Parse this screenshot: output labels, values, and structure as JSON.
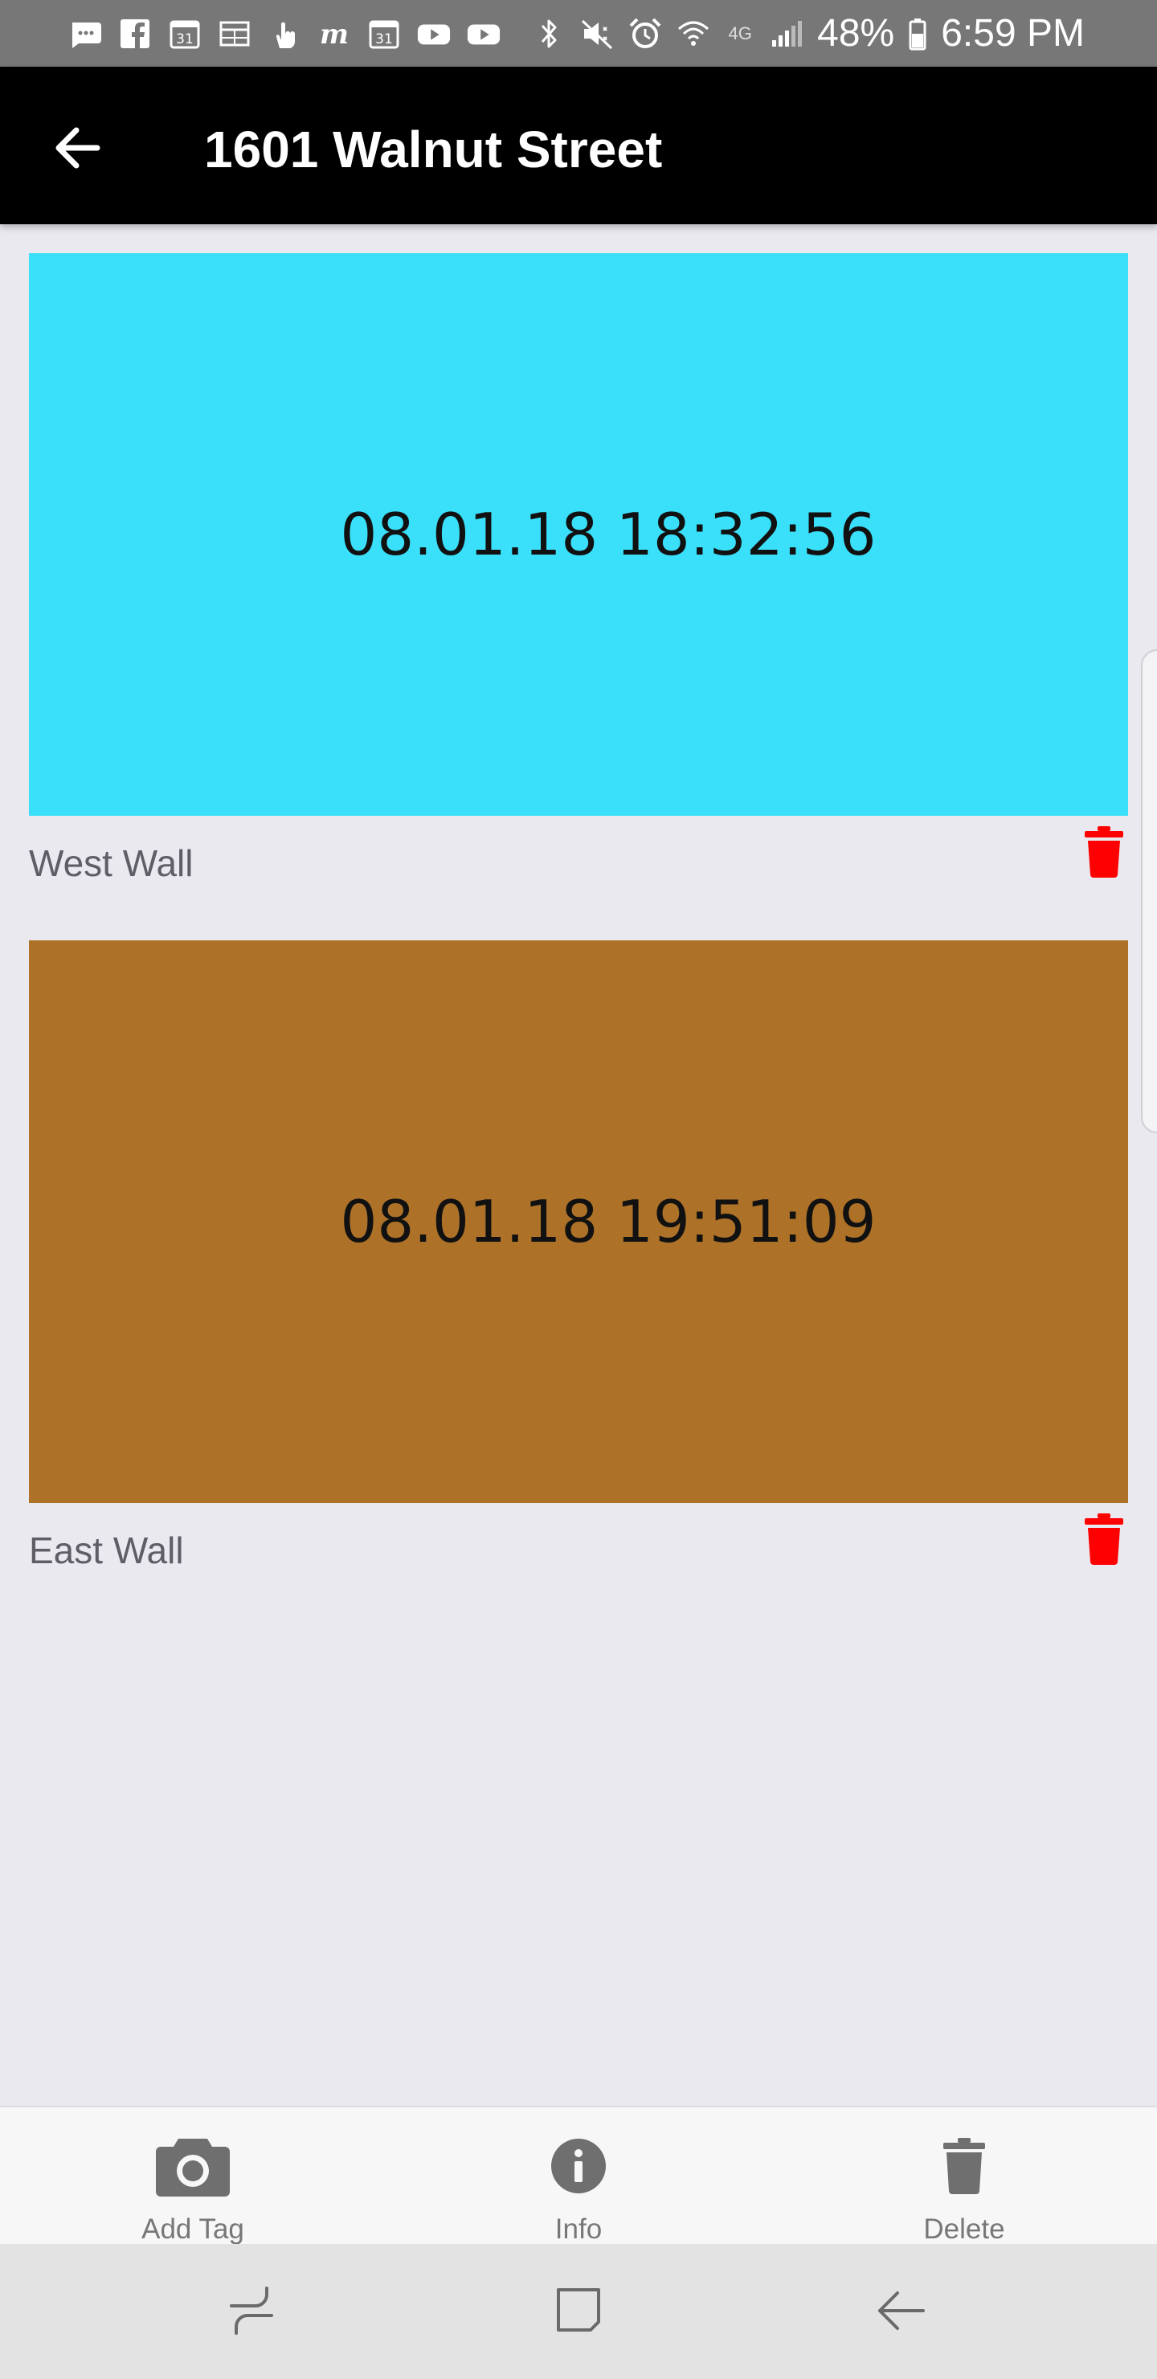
{
  "status_bar": {
    "battery_percent": "48%",
    "time": "6:59 PM",
    "network": "4G",
    "notification_icons": [
      "chat-icon",
      "facebook-icon",
      "calendar-icon",
      "grid-icon",
      "gesture-icon",
      "m-app-icon",
      "calendar-icon",
      "youtube-icon",
      "youtube-icon"
    ],
    "system_icons": [
      "bluetooth-icon",
      "mute-icon",
      "alarm-icon",
      "wifi-icon",
      "signal-icon",
      "battery-icon"
    ]
  },
  "app_bar": {
    "back_icon": "arrow-left-icon",
    "title": "1601 Walnut Street"
  },
  "tags": [
    {
      "timestamp": "08.01.18 18:32:56",
      "label": "West Wall",
      "color": "#3ae0fa",
      "delete_icon": "trash-icon"
    },
    {
      "timestamp": "08.01.18 19:51:09",
      "label": "East Wall",
      "color": "#ad7128",
      "delete_icon": "trash-icon"
    }
  ],
  "colors": {
    "delete_red": "#ff0000",
    "toolbar_icon": "#6f6f6f",
    "background": "#eae9ef"
  },
  "toolbar": {
    "add_tag_label": "Add Tag",
    "info_label": "Info",
    "delete_label": "Delete",
    "icons": [
      "camera-icon",
      "info-icon",
      "trash-icon"
    ]
  },
  "nav_bar": {
    "icons": [
      "recents-icon",
      "home-icon",
      "back-icon"
    ]
  }
}
